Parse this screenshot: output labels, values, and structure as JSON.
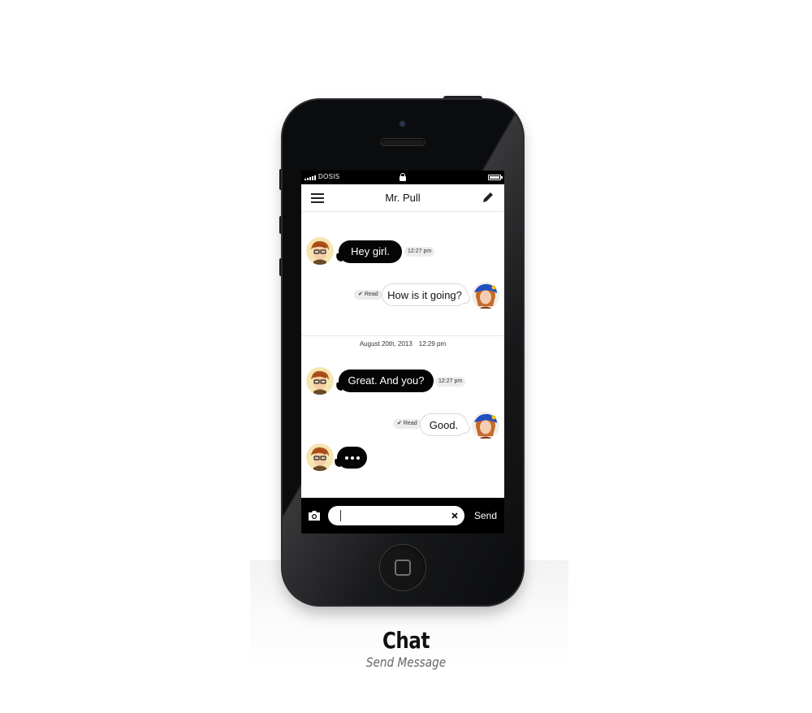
{
  "statusbar": {
    "carrier": "DOSIS"
  },
  "navbar": {
    "title": "Mr. Pull"
  },
  "messages": [
    {
      "text": "Hey girl.",
      "time": "12:27 pm"
    },
    {
      "text": "How is it going?",
      "status": "Read"
    },
    {
      "text": "Great. And you?",
      "time": "12:27 pm"
    },
    {
      "text": "Good.",
      "status": "Read"
    }
  ],
  "date_separator": {
    "date": "August 20th, 2013",
    "time": "12:29 pm"
  },
  "composer": {
    "input_value": "",
    "send_label": "Send"
  },
  "caption": {
    "title": "Chat",
    "subtitle": "Send Message"
  },
  "colors": {
    "bubble_dark": "#050505",
    "bubble_light": "#ffffff",
    "accent": "#1f4fc1"
  }
}
